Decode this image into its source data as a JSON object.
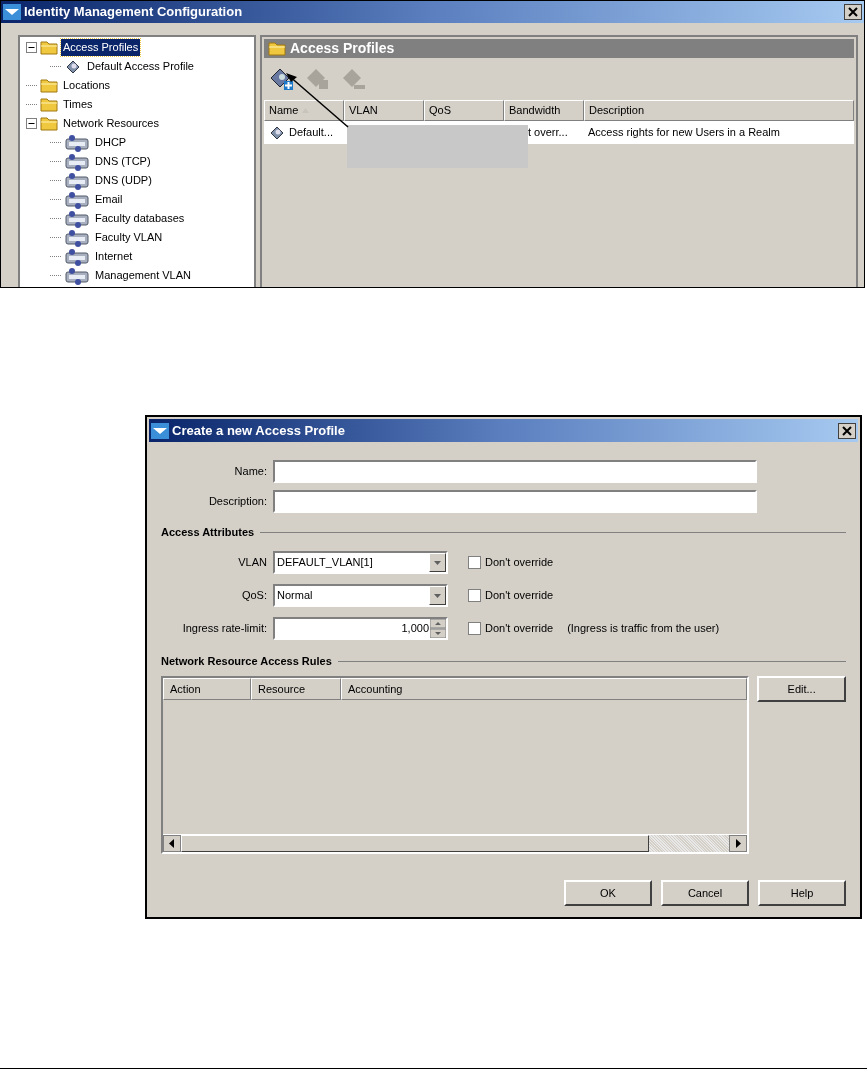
{
  "window": {
    "title": "Identity Management Configuration"
  },
  "tree": [
    {
      "label": "Access Profiles",
      "kind": "folder",
      "selected": true,
      "expanded": true,
      "children": [
        {
          "label": "Default Access Profile",
          "kind": "profile",
          "selected": false
        }
      ]
    },
    {
      "label": "Locations",
      "kind": "folder",
      "selected": false
    },
    {
      "label": "Times",
      "kind": "folder",
      "selected": false
    },
    {
      "label": "Network Resources",
      "kind": "folder",
      "selected": false,
      "expanded": true,
      "children": [
        {
          "label": "DHCP",
          "kind": "resource",
          "selected": false
        },
        {
          "label": "DNS (TCP)",
          "kind": "resource",
          "selected": false
        },
        {
          "label": "DNS (UDP)",
          "kind": "resource",
          "selected": false
        },
        {
          "label": "Email",
          "kind": "resource",
          "selected": false
        },
        {
          "label": "Faculty databases",
          "kind": "resource",
          "selected": false
        },
        {
          "label": "Faculty VLAN",
          "kind": "resource",
          "selected": false
        },
        {
          "label": "Internet",
          "kind": "resource",
          "selected": false
        },
        {
          "label": "Management VLAN",
          "kind": "resource",
          "selected": false
        }
      ]
    }
  ],
  "panel": {
    "title": "Access Profiles",
    "toolbar": [
      {
        "kind": "add",
        "disabled": false
      },
      {
        "kind": "edit",
        "disabled": true
      },
      {
        "kind": "delete",
        "disabled": true
      }
    ],
    "columns": [
      "Name",
      "VLAN",
      "QoS",
      "Bandwidth",
      "Description"
    ],
    "rows": [
      {
        "name": "Default...",
        "bandwidth": "t overr...",
        "description": "Access rights for new Users in a Realm"
      }
    ]
  },
  "dialog": {
    "title": "Create a new Access Profile",
    "fields": [
      {
        "label": "Name:"
      },
      {
        "label": "Description:"
      }
    ],
    "sections": [
      {
        "title": "Access Attributes",
        "rows": [
          {
            "kind": "combo",
            "label": "VLAN",
            "value": "DEFAULT_VLAN[1]",
            "checkbox": {
              "label": "Don't override",
              "checked": false
            }
          },
          {
            "kind": "combo",
            "label": "QoS:",
            "value": "Normal",
            "checkbox": {
              "label": "Don't override",
              "checked": false
            }
          },
          {
            "kind": "spinner",
            "label": "Ingress rate-limit:",
            "value": "1,000",
            "checkbox": {
              "label": "Don't override",
              "checked": false
            },
            "note": "(Ingress is traffic from the user)"
          }
        ]
      },
      {
        "title": "Network Resource Access Rules",
        "table": {
          "columns": [
            "Action",
            "Resource",
            "Accounting"
          ]
        },
        "side_button": "Edit..."
      }
    ],
    "buttons": [
      "OK",
      "Cancel",
      "Help"
    ]
  }
}
